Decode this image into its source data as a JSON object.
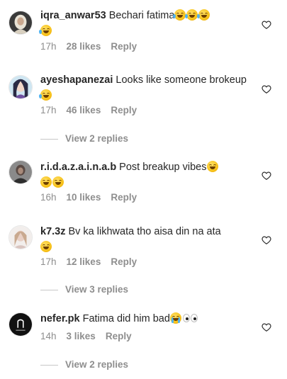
{
  "comments": [
    {
      "username": "iqra_anwar53",
      "text": "Bechari fatima",
      "time": "17h",
      "likes": "28 likes",
      "reply": "Reply"
    },
    {
      "username": "ayeshapanezai",
      "text": "Looks like someone brokeup",
      "time": "17h",
      "likes": "46 likes",
      "reply": "Reply",
      "view_replies": "View 2 replies"
    },
    {
      "username": "r.i.d.a.z.a.i.n.a.b",
      "text": "Post breakup vibes",
      "time": "16h",
      "likes": "10 likes",
      "reply": "Reply"
    },
    {
      "username": "k7.3z",
      "text": "Bv ka likhwata tho aisa din na ata",
      "time": "17h",
      "likes": "12 likes",
      "reply": "Reply",
      "view_replies": "View 3 replies"
    },
    {
      "username": "nefer.pk",
      "text": "Fatima did him bad",
      "time": "14h",
      "likes": "3 likes",
      "reply": "Reply",
      "view_replies": "View 2 replies"
    }
  ],
  "emojis": {
    "c0": [
      "rofl",
      "rofl",
      "rofl",
      "rofl"
    ],
    "c1": [
      "rofl"
    ],
    "c2": [
      "joy",
      "joy",
      "joy"
    ],
    "c3": [
      "joy"
    ],
    "c4": [
      "cry",
      "eyes"
    ]
  },
  "colors": {
    "text": "#262626",
    "meta": "#8e8e8e",
    "emoji": "#f7c21b"
  }
}
